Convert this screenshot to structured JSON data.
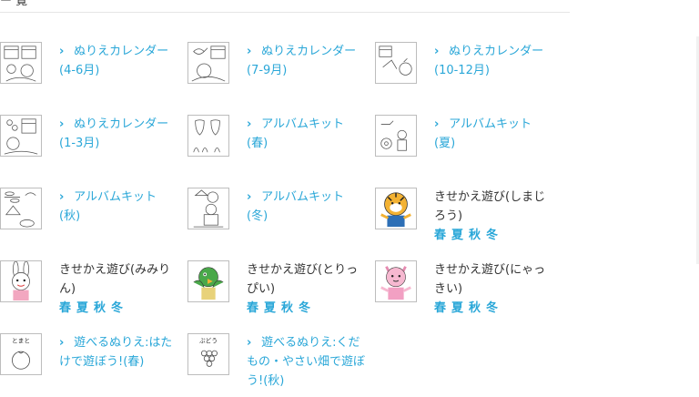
{
  "header": {
    "partial_text": "ー 覧"
  },
  "items": [
    {
      "type": "link",
      "line1": "ぬりえカレンダー",
      "line2": "(4-6月)",
      "thumb": "calendar-flower-icon"
    },
    {
      "type": "link",
      "line1": "ぬりえカレンダー",
      "line2": "(7-9月)",
      "thumb": "calendar-fish-icon"
    },
    {
      "type": "link",
      "line1": "ぬりえカレンダー",
      "line2": "(10-12月)",
      "thumb": "calendar-pumpkin-icon"
    },
    {
      "type": "link",
      "line1": "ぬりえカレンダー",
      "line2": "(1-3月)",
      "thumb": "calendar-snowman-icon"
    },
    {
      "type": "link",
      "line1": "アルバムキット",
      "line2": "(春)",
      "thumb": "album-strawberry-icon"
    },
    {
      "type": "link",
      "line1": "アルバムキット",
      "line2": "(夏)",
      "thumb": "album-sunflower-icon"
    },
    {
      "type": "link",
      "line1": "アルバムキット",
      "line2": "(秋)",
      "thumb": "album-dragonfly-icon"
    },
    {
      "type": "link",
      "line1": "アルバムキット",
      "line2": "(冬)",
      "thumb": "album-santa-icon"
    },
    {
      "type": "dress",
      "line1": "きせかえ遊び(しまじ",
      "line2": "ろう)",
      "seasons": [
        "春",
        "夏",
        "秋",
        "冬"
      ],
      "thumb": "shimajiro-icon"
    },
    {
      "type": "dress",
      "line1": "きせかえ遊び(みみり",
      "line2": "ん)",
      "seasons": [
        "春",
        "夏",
        "秋",
        "冬"
      ],
      "thumb": "mimirin-icon"
    },
    {
      "type": "dress",
      "line1": "きせかえ遊び(とりっ",
      "line2": "ぴい)",
      "seasons": [
        "春",
        "夏",
        "秋",
        "冬"
      ],
      "thumb": "torippi-icon"
    },
    {
      "type": "dress",
      "line1": "きせかえ遊び(にゃっ",
      "line2": "きい)",
      "seasons": [
        "春",
        "夏",
        "秋",
        "冬"
      ],
      "thumb": "nyakki-icon"
    },
    {
      "type": "link",
      "line1": "遊べるぬりえ:はた",
      "line2": "けで遊ぼう!(春)",
      "thumb": "tomato-icon",
      "thumb_label": "とまと"
    },
    {
      "type": "link3",
      "line1": "遊べるぬりえ:くだ",
      "line2": "もの・やさい畑で遊ぼ",
      "line3": "う!(秋)",
      "thumb": "grape-icon",
      "thumb_label": "ぶどう"
    }
  ],
  "chevron": "›"
}
